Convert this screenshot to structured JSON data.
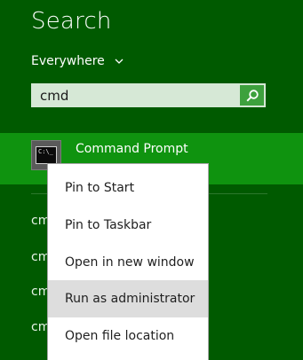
{
  "search": {
    "title": "Search",
    "scope": "Everywhere",
    "query": "cmd"
  },
  "results": {
    "selected": {
      "label": "Command Prompt",
      "icon_text": "C:\\_"
    },
    "others": [
      {
        "label": "cmd"
      },
      {
        "label": "cmd"
      },
      {
        "label": "cmd"
      },
      {
        "label": "cmd"
      }
    ]
  },
  "context_menu": {
    "items": [
      {
        "label": "Pin to Start"
      },
      {
        "label": "Pin to Taskbar"
      },
      {
        "label": "Open in new window"
      },
      {
        "label": "Run as administrator",
        "highlighted": true
      },
      {
        "label": "Open file location"
      }
    ]
  },
  "colors": {
    "background": "#005a00",
    "selected_result": "#0f930f",
    "search_box": "#d6e8d6",
    "search_button": "#3da13d",
    "menu_highlight": "#dddddd"
  },
  "icons": {
    "scope_chevron": "chevron-down-icon",
    "search_button": "search-icon",
    "app": "command-prompt-icon"
  }
}
